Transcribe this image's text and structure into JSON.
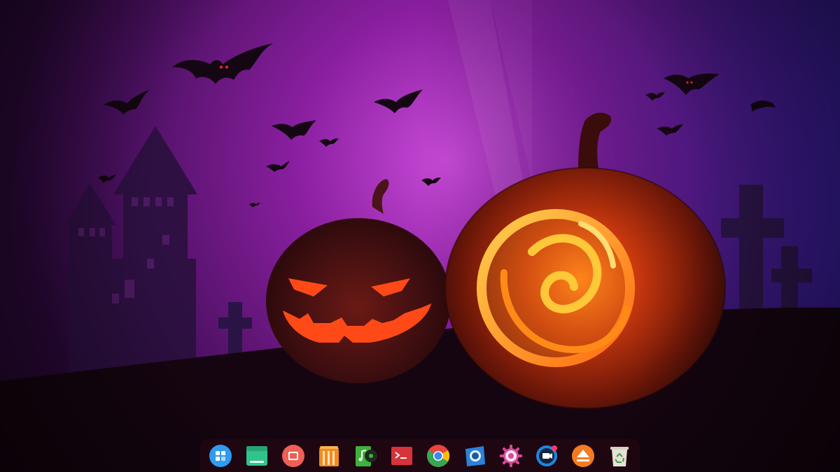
{
  "desktop": {
    "wallpaper": {
      "theme": "halloween-night",
      "elements": [
        "castle-silhouette",
        "bats",
        "jack-o-lantern",
        "deepin-logo-pumpkin",
        "graveyard-crosses"
      ],
      "colors": {
        "sky_top": "#5b1268",
        "sky_glow": "#b23cc8",
        "sky_right": "#3a1fb0",
        "hill": "#150510",
        "pumpkin_dark": "#3a0c0c",
        "pumpkin_glow": "#ff5a12",
        "logo_glow": "#ffb020"
      }
    }
  },
  "dock": {
    "items": [
      {
        "name": "launcher",
        "icon": "launcher-icon",
        "color": "#2e9bef"
      },
      {
        "name": "file-manager",
        "icon": "file-manager-icon",
        "color": "#2fc48a"
      },
      {
        "name": "movie-player",
        "icon": "movie-icon",
        "color": "#ef5f55"
      },
      {
        "name": "app-store",
        "icon": "store-icon",
        "color": "#f28a1e"
      },
      {
        "name": "music",
        "icon": "music-icon",
        "color": "#3fb23a"
      },
      {
        "name": "terminal",
        "icon": "terminal-icon",
        "color": "#d8323a"
      },
      {
        "name": "browser",
        "icon": "chrome-icon",
        "color": "#e8453c"
      },
      {
        "name": "screenshot",
        "icon": "screenshot-icon",
        "color": "#2b82d9"
      },
      {
        "name": "control-center",
        "icon": "gear-icon",
        "color": "#d9489a"
      },
      {
        "name": "screen-recorder",
        "icon": "camera-icon",
        "color": "#1e86e0"
      },
      {
        "name": "disk-utility",
        "icon": "eject-icon",
        "color": "#f47b20"
      },
      {
        "name": "trash",
        "icon": "trash-icon",
        "color": "#e6e2d8"
      }
    ]
  }
}
